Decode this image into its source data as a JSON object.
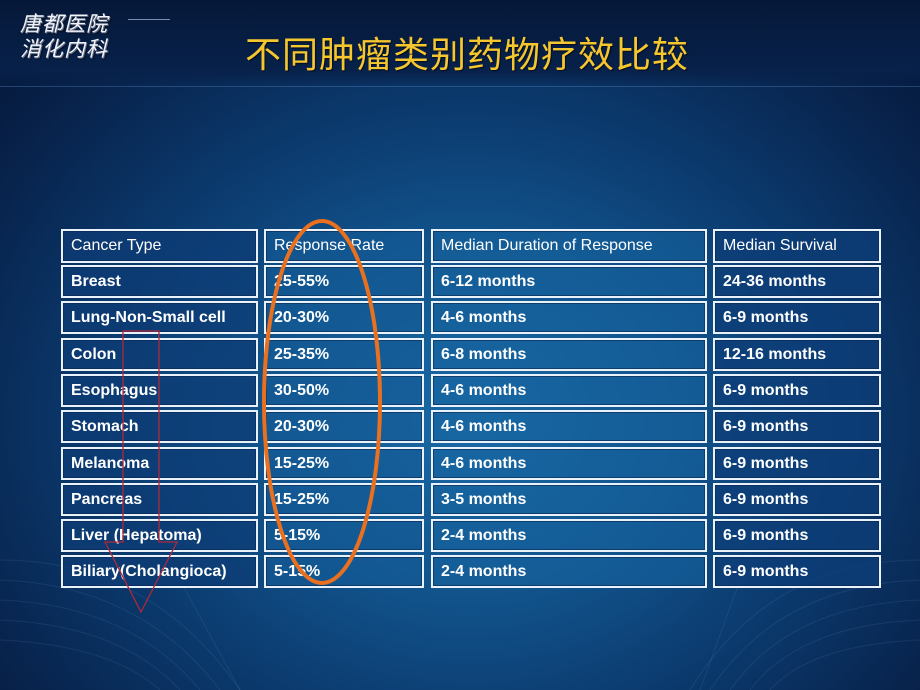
{
  "header": {
    "department_lines": [
      "唐都医院",
      "消化内科"
    ],
    "title": "不同肿瘤类别药物疗效比较"
  },
  "table": {
    "columns": [
      "Cancer Type",
      "Response Rate",
      "Median Duration of Response",
      "Median Survival"
    ],
    "rows": [
      [
        "Breast",
        "25-55%",
        "6-12 months",
        "24-36 months"
      ],
      [
        "Lung-Non-Small cell",
        "20-30%",
        "4-6 months",
        "6-9 months"
      ],
      [
        "Colon",
        "25-35%",
        "6-8 months",
        "12-16 months"
      ],
      [
        "Esophagus",
        "30-50%",
        "4-6 months",
        "6-9 months"
      ],
      [
        "Stomach",
        "20-30%",
        "4-6 months",
        "6-9 months"
      ],
      [
        "Melanoma",
        "15-25%",
        "4-6 months",
        "6-9 months"
      ],
      [
        "Pancreas",
        "15-25%",
        "3-5 months",
        "6-9 months"
      ],
      [
        "Liver (Hepatoma)",
        "5-15%",
        "2-4 months",
        "6-9 months"
      ],
      [
        "Biliary(Cholangioca)",
        "5-15%",
        "2-4 months",
        "6-9 months"
      ]
    ]
  },
  "annotations": {
    "highlight_ellipse": {
      "target": "Response Rate column",
      "color": "#e8701e"
    },
    "down_arrow": {
      "target": "Cancer Type column",
      "color": "#b0283a"
    }
  },
  "theme": {
    "title_color": "#f6c62e",
    "cell_border": "#e9f1fb",
    "text_color": "#ffffff"
  }
}
